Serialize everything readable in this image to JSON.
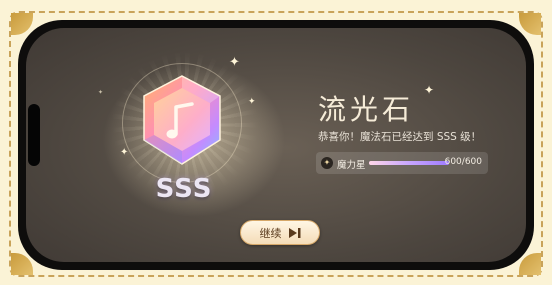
{
  "result": {
    "title": "流光石",
    "message": "恭喜你！魔法石已经达到 SSS 级！",
    "grade": "SSS"
  },
  "stat": {
    "label": "魔力星",
    "value_text": "600/600",
    "progress": 1.0
  },
  "actions": {
    "continue_label": "继续"
  },
  "icons": {
    "gem": "music-note-gem-icon",
    "continue": "skip-next-icon",
    "stat": "star-drop-icon"
  },
  "colors": {
    "frame": "#c9a35a",
    "button_border": "#d6a869",
    "button_text": "#5a3a1c"
  }
}
